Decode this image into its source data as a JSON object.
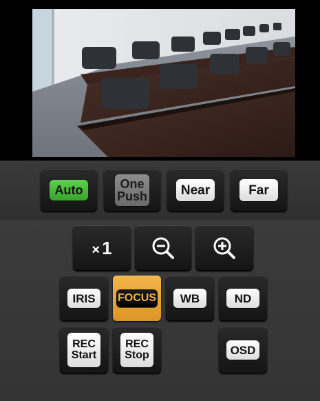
{
  "focus_controls": {
    "auto_label": "Auto",
    "one_push_label_1": "One",
    "one_push_label_2": "Push",
    "near_label": "Near",
    "far_label": "Far"
  },
  "zoom": {
    "multiplier_symbol": "×",
    "multiplier_value": "1",
    "zoom_out_icon": "zoom-out-icon",
    "zoom_in_icon": "zoom-in-icon"
  },
  "mode_buttons": {
    "iris_label": "IRIS",
    "focus_label": "FOCUS",
    "wb_label": "WB",
    "nd_label": "ND",
    "active": "FOCUS"
  },
  "rec": {
    "start_line_1": "REC",
    "start_line_2": "Start",
    "stop_line_1": "REC",
    "stop_line_2": "Stop",
    "osd_label": "OSD"
  },
  "colors": {
    "active_orange": "#f1b64a",
    "auto_green": "#4cbf3b",
    "panel_bg": "#383838"
  }
}
